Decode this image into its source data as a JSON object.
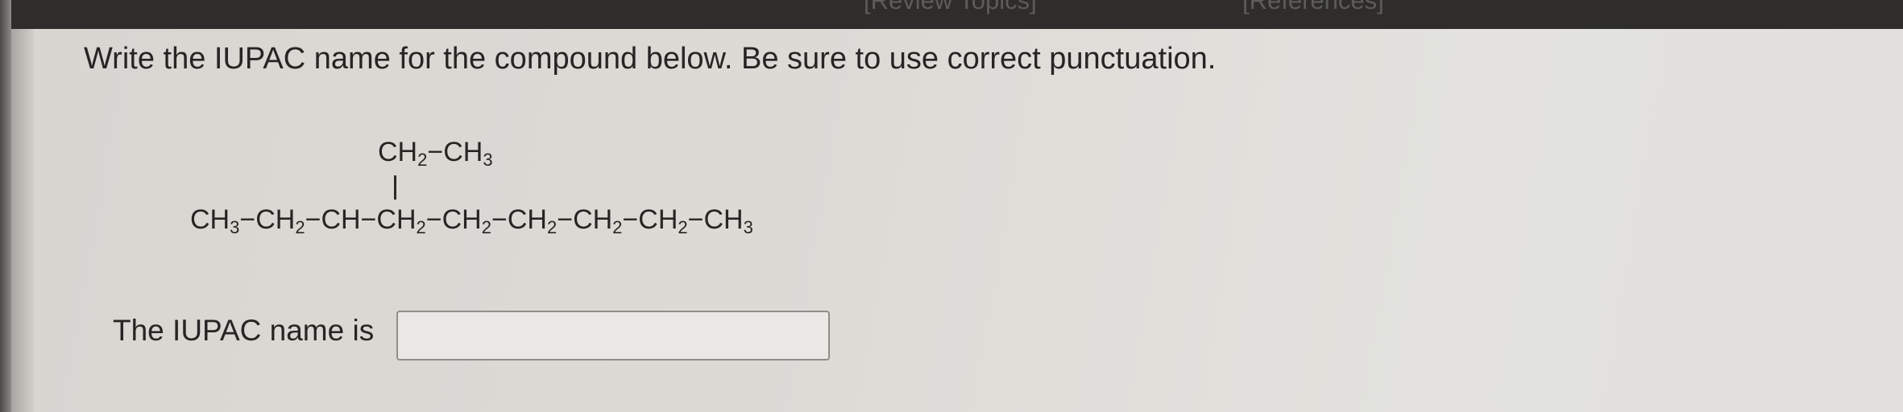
{
  "nav": {
    "review_topics": "[Review Topics]",
    "references": "[References]"
  },
  "question": {
    "text": "Write the IUPAC name for the compound below. Be sure to use correct punctuation."
  },
  "structure": {
    "branch": {
      "ch2": "CH",
      "ch2_sub": "2",
      "dash": "−",
      "ch3": "CH",
      "ch3_sub": "3"
    },
    "main_chain": [
      {
        "text": "CH",
        "sub": "3"
      },
      {
        "text": "CH",
        "sub": "2"
      },
      {
        "text": "CH",
        "sub": ""
      },
      {
        "text": "CH",
        "sub": "2"
      },
      {
        "text": "CH",
        "sub": "2"
      },
      {
        "text": "CH",
        "sub": "2"
      },
      {
        "text": "CH",
        "sub": "2"
      },
      {
        "text": "CH",
        "sub": "2"
      },
      {
        "text": "CH",
        "sub": "3"
      }
    ],
    "bond": "−"
  },
  "answer": {
    "label": "The IUPAC name is",
    "value": ""
  }
}
